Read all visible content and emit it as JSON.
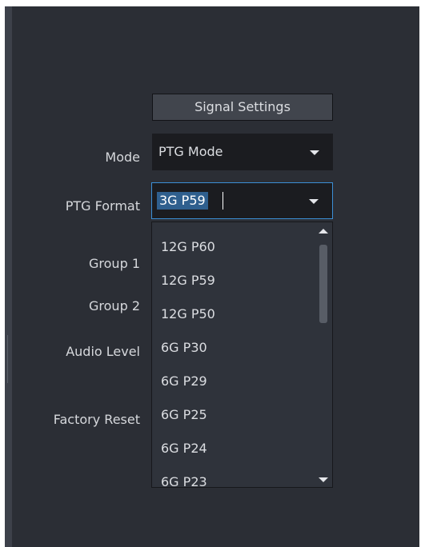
{
  "section": {
    "title": "Signal Settings"
  },
  "labels": {
    "mode": "Mode",
    "ptg_format": "PTG Format",
    "group1": "Group 1",
    "group2": "Group 2",
    "audio_level": "Audio Level",
    "factory_reset": "Factory Reset"
  },
  "mode_dropdown": {
    "value": "PTG Mode",
    "icon": "chevron-down-icon"
  },
  "ptg_dropdown": {
    "value": "3G P59",
    "icon": "chevron-down-icon",
    "state": "focused-editing"
  },
  "ptg_options": [
    "12G P60",
    "12G P59",
    "12G P50",
    "6G P30",
    "6G P29",
    "6G P25",
    "6G P24",
    "6G P23"
  ],
  "scrollbar": {
    "up_icon": "scroll-up-arrow-icon",
    "down_icon": "scroll-down-arrow-icon"
  },
  "colors": {
    "panel_bg": "#2b2e35",
    "field_bg": "#1b1c20",
    "focus_border": "#3c8fd6",
    "selection_bg": "#2f5f8e",
    "text": "#dcdee2"
  }
}
